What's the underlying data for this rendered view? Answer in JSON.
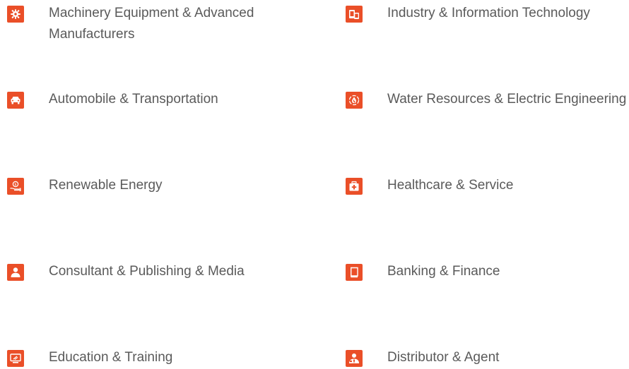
{
  "accent_color": "#ea4f28",
  "text_color": "#5a5a5a",
  "items": [
    {
      "label": "Machinery Equipment & Advanced Manufacturers",
      "icon": "gear-icon"
    },
    {
      "label": "Industry & Information Technology",
      "icon": "devices-icon"
    },
    {
      "label": "Automobile & Transportation",
      "icon": "car-icon"
    },
    {
      "label": "Water Resources & Electric Engineering",
      "icon": "water-drop-icon"
    },
    {
      "label": "Renewable Energy",
      "icon": "money-hand-icon"
    },
    {
      "label": "Healthcare & Service",
      "icon": "medical-kit-icon"
    },
    {
      "label": "Consultant & Publishing & Media",
      "icon": "person-icon"
    },
    {
      "label": "Banking & Finance",
      "icon": "book-icon"
    },
    {
      "label": "Education & Training",
      "icon": "monitor-icon"
    },
    {
      "label": "Distributor & Agent",
      "icon": "agent-icon"
    }
  ]
}
